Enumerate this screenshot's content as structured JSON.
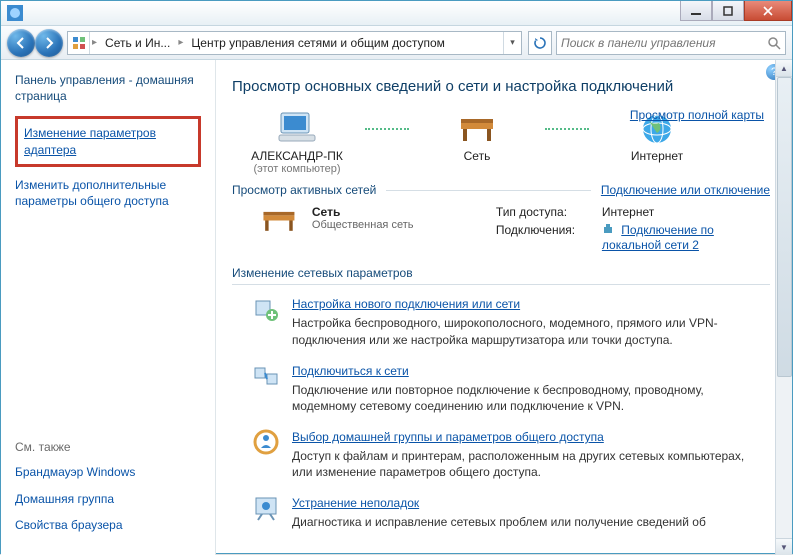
{
  "titlebar": {},
  "nav": {
    "crumb1": "Сеть и Ин...",
    "crumb2": "Центр управления сетями и общим доступом",
    "search_placeholder": "Поиск в панели управления"
  },
  "sidebar": {
    "home": "Панель управления - домашняя страница",
    "adapter_link": "Изменение параметров адаптера",
    "advanced_sharing": "Изменить дополнительные параметры общего доступа",
    "see_also": "См. также",
    "firewall": "Брандмауэр Windows",
    "homegroup": "Домашняя группа",
    "browser": "Свойства браузера"
  },
  "main": {
    "heading": "Просмотр основных сведений о сети и настройка подключений",
    "map_link": "Просмотр полной карты",
    "overview": {
      "pc_label": "АЛЕКСАНДР-ПК",
      "pc_sub": "(этот компьютер)",
      "net_label": "Сеть",
      "inet_label": "Интернет"
    },
    "active_header": "Просмотр активных сетей",
    "active_link": "Подключение или отключение",
    "network": {
      "name": "Сеть",
      "type": "Общественная сеть",
      "k_access": "Тип доступа:",
      "v_access": "Интернет",
      "k_conn": "Подключения:",
      "v_conn": "Подключение по локальной сети 2"
    },
    "change_header": "Изменение сетевых параметров",
    "tasks": [
      {
        "title": "Настройка нового подключения или сети",
        "desc": "Настройка беспроводного, широкополосного, модемного, прямого или VPN-подключения или же настройка маршрутизатора или точки доступа."
      },
      {
        "title": "Подключиться к сети",
        "desc": "Подключение или повторное подключение к беспроводному, проводному, модемному сетевому соединению или подключение к VPN."
      },
      {
        "title": "Выбор домашней группы и параметров общего доступа",
        "desc": "Доступ к файлам и принтерам, расположенным на других сетевых компьютерах, или изменение параметров общего доступа."
      },
      {
        "title": "Устранение неполадок",
        "desc": "Диагностика и исправление сетевых проблем или получение сведений об"
      }
    ]
  }
}
